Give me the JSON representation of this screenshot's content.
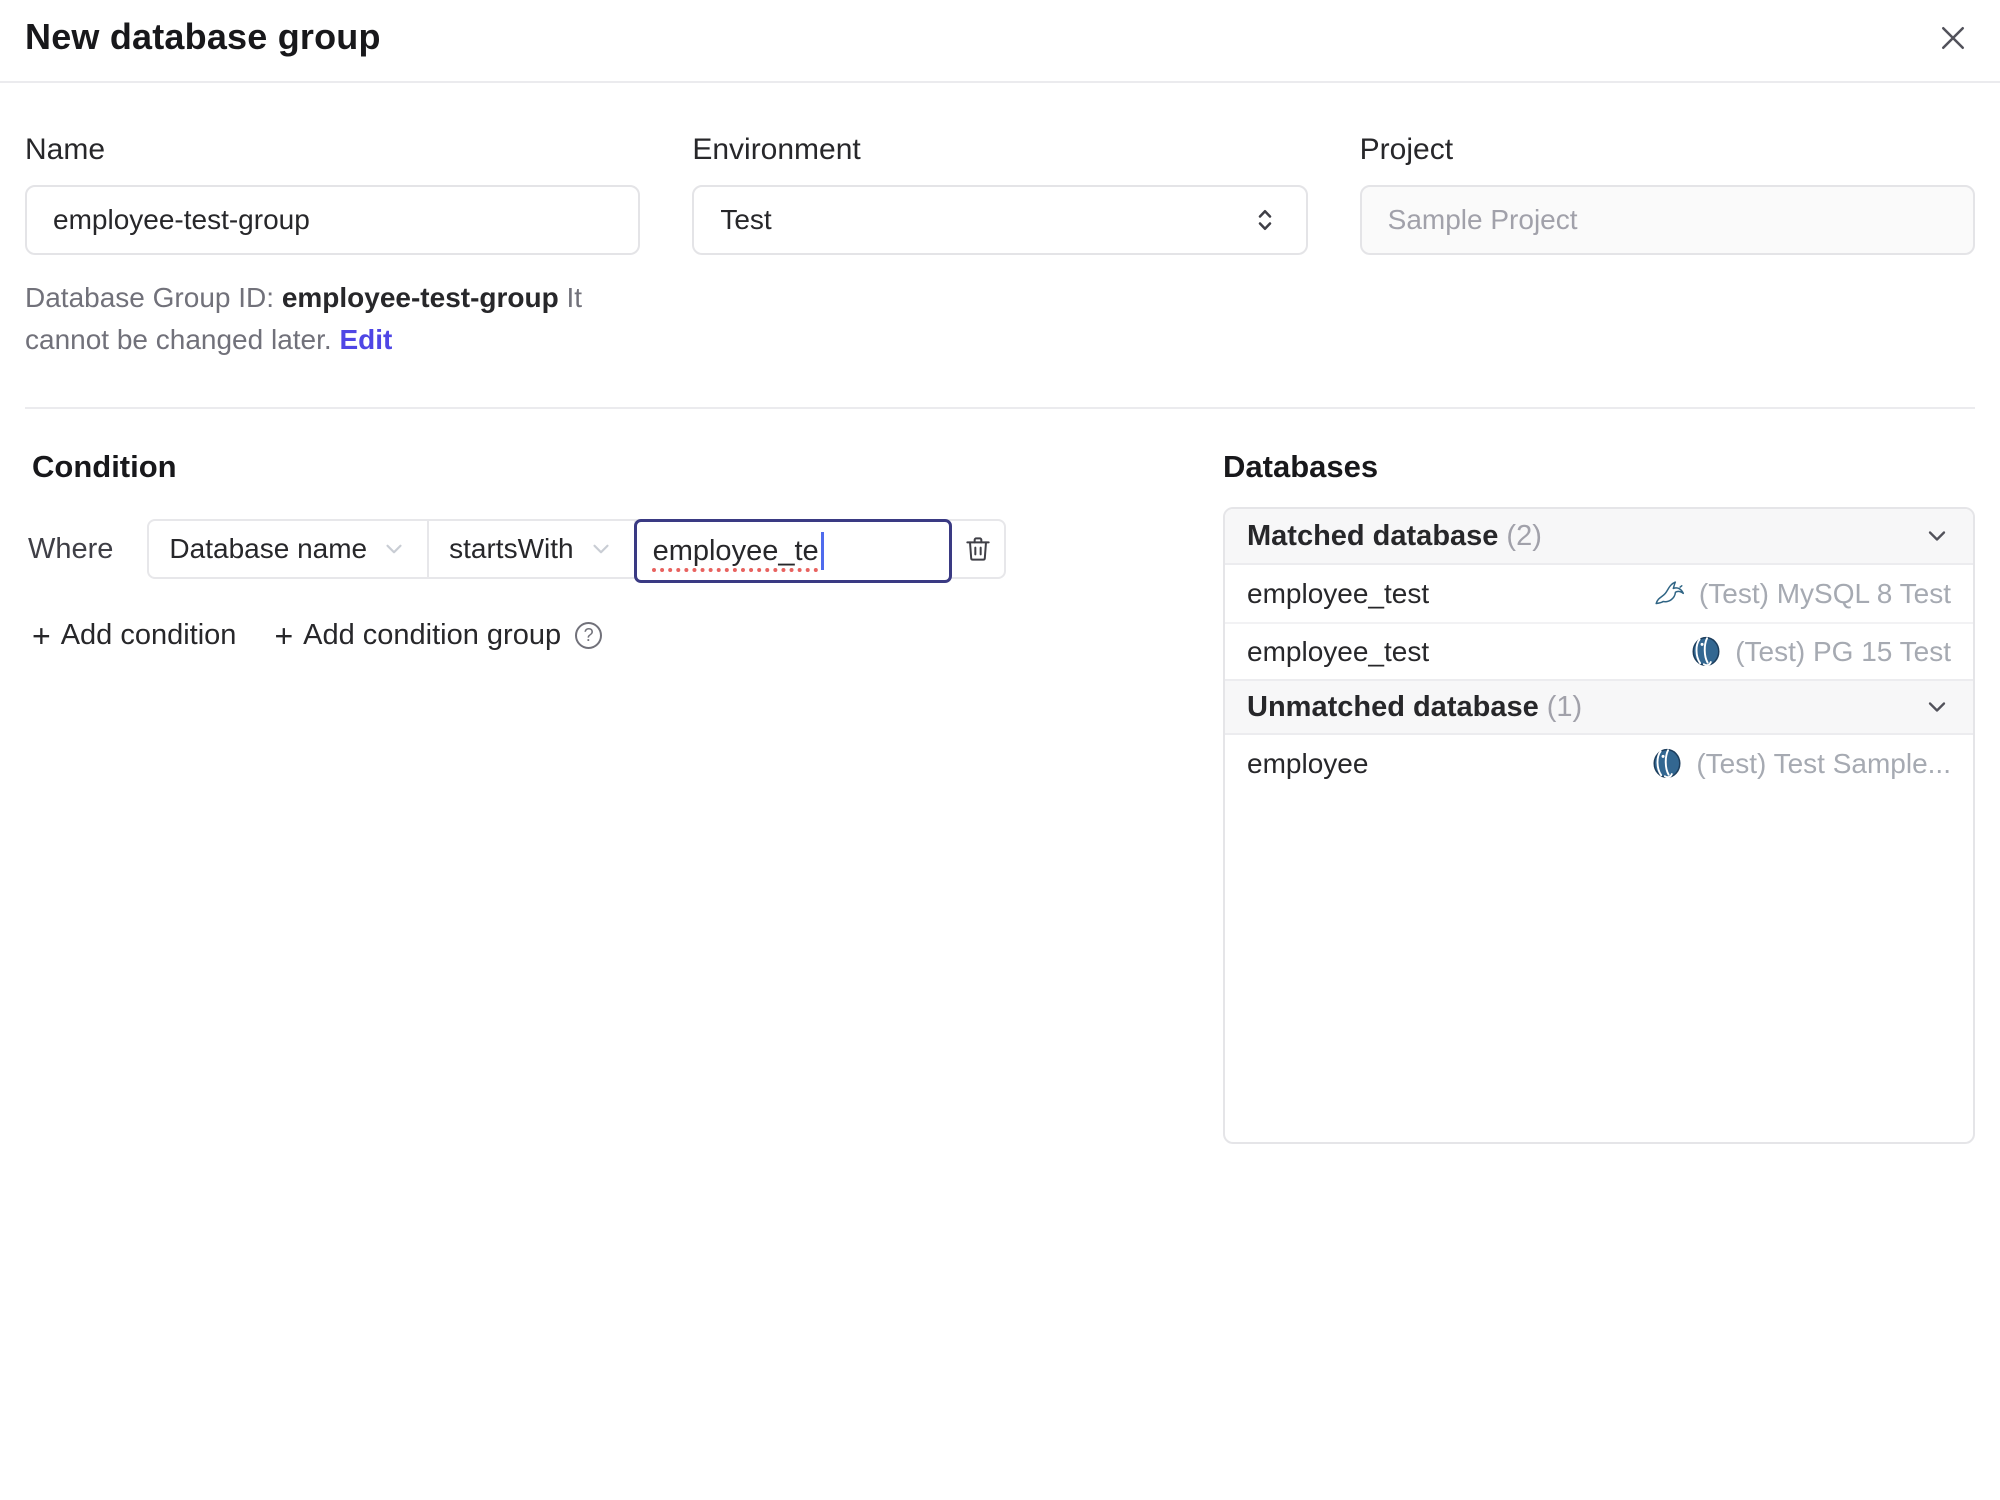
{
  "dialog": {
    "title": "New database group"
  },
  "form": {
    "name": {
      "label": "Name",
      "value": "employee-test-group"
    },
    "environment": {
      "label": "Environment",
      "value": "Test"
    },
    "project": {
      "label": "Project",
      "value": "Sample Project"
    },
    "id_hint": {
      "prefix": "Database Group ID:",
      "id": "employee-test-group",
      "suffix": "It cannot be changed later.",
      "edit_label": "Edit"
    }
  },
  "condition": {
    "heading": "Condition",
    "where_label": "Where",
    "factor": "Database name",
    "operator": "startsWith",
    "value": "employee_te",
    "add_condition_label": "Add condition",
    "add_condition_group_label": "Add condition group"
  },
  "databases": {
    "heading": "Databases",
    "matched": {
      "title": "Matched database",
      "count": "(2)",
      "rows": [
        {
          "name": "employee_test",
          "engine": "mysql",
          "instance": "(Test) MySQL 8 Test"
        },
        {
          "name": "employee_test",
          "engine": "postgresql",
          "instance": "(Test) PG 15 Test"
        }
      ]
    },
    "unmatched": {
      "title": "Unmatched database",
      "count": "(1)",
      "rows": [
        {
          "name": "employee",
          "engine": "postgresql",
          "instance": "(Test) Test Sample..."
        }
      ]
    }
  },
  "colors": {
    "accent_link": "#4f46e5",
    "focus_border": "#3a3a83",
    "caret": "#4f6bed",
    "spellcheck_underline": "#e8625f",
    "muted_text": "#a1a1aa",
    "header_bg": "#f7f7f8",
    "postgres_blue": "#336791",
    "mysql_blue": "#2f6484"
  }
}
